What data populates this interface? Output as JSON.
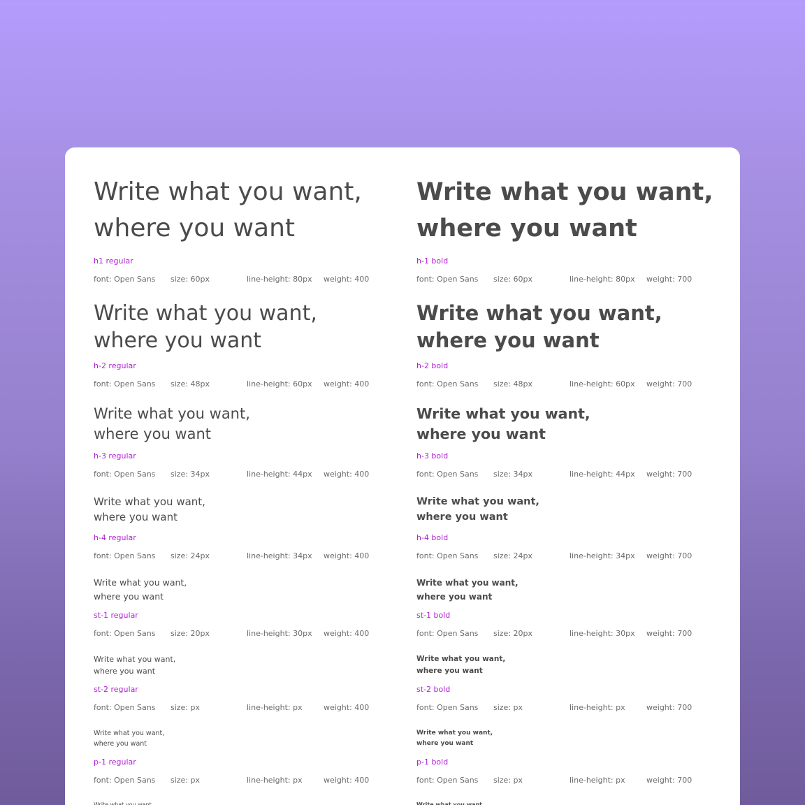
{
  "sample_line1": "Write what you want,",
  "sample_line2": "where you want",
  "left_column": [
    {
      "label": "h1 regular",
      "font": "font: Open Sans",
      "size": "size: 60px",
      "line_height": "line-height: 80px",
      "weight": "weight: 400"
    },
    {
      "label": "h-2 regular",
      "font": "font: Open Sans",
      "size": "size: 48px",
      "line_height": "line-height: 60px",
      "weight": "weight: 400"
    },
    {
      "label": "h-3 regular",
      "font": "font: Open Sans",
      "size": "size: 34px",
      "line_height": "line-height: 44px",
      "weight": "weight: 400"
    },
    {
      "label": "h-4 regular",
      "font": "font: Open Sans",
      "size": "size: 24px",
      "line_height": "line-height: 34px",
      "weight": "weight: 400"
    },
    {
      "label": "st-1 regular",
      "font": "font: Open Sans",
      "size": "size: 20px",
      "line_height": "line-height: 30px",
      "weight": "weight: 400"
    },
    {
      "label": "st-2 regular",
      "font": "font: Open Sans",
      "size": "size: px",
      "line_height": "line-height: px",
      "weight": "weight: 400"
    },
    {
      "label": "p-1 regular",
      "font": "font: Open Sans",
      "size": "size: px",
      "line_height": "line-height: px",
      "weight": "weight: 400"
    }
  ],
  "right_column": [
    {
      "label": "h-1 bold",
      "font": "font: Open Sans",
      "size": "size: 60px",
      "line_height": "line-height: 80px",
      "weight": "weight: 700"
    },
    {
      "label": "h-2 bold",
      "font": "font: Open Sans",
      "size": "size: 48px",
      "line_height": "line-height: 60px",
      "weight": "weight: 700"
    },
    {
      "label": "h-3 bold",
      "font": "font: Open Sans",
      "size": "size: 34px",
      "line_height": "line-height: 44px",
      "weight": "weight: 700"
    },
    {
      "label": "h-4 bold",
      "font": "font: Open Sans",
      "size": "size: 24px",
      "line_height": "line-height: 34px",
      "weight": "weight: 700"
    },
    {
      "label": "st-1 bold",
      "font": "font: Open Sans",
      "size": "size: 20px",
      "line_height": "line-height: 30px",
      "weight": "weight: 700"
    },
    {
      "label": "st-2 bold",
      "font": "font: Open Sans",
      "size": "size: px",
      "line_height": "line-height: px",
      "weight": "weight: 700"
    },
    {
      "label": "p-1 bold",
      "font": "font: Open Sans",
      "size": "size: px",
      "line_height": "line-height: px",
      "weight": "weight: 700"
    }
  ],
  "colors": {
    "label": "#b21fd6",
    "sample_text": "#4b4b4b",
    "spec_text": "#6b6b6b",
    "background_top": "#b39cfc",
    "background_bottom": "#6f5c9c",
    "card": "#ffffff"
  }
}
